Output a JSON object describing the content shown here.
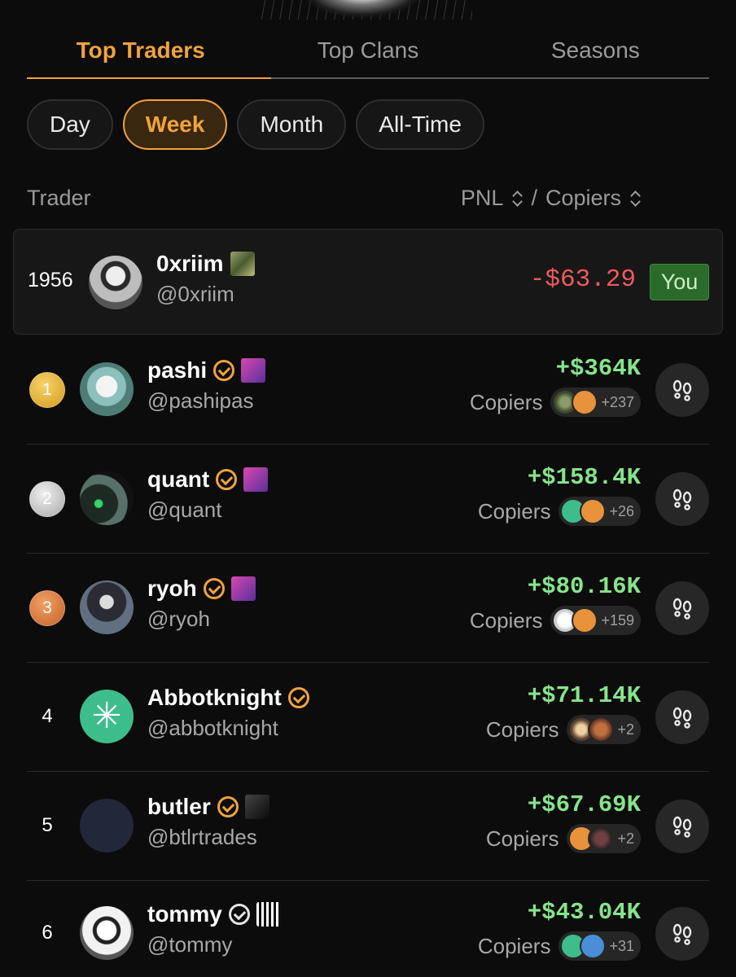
{
  "tabs": [
    {
      "label": "Top Traders",
      "active": true
    },
    {
      "label": "Top Clans",
      "active": false
    },
    {
      "label": "Seasons",
      "active": false
    }
  ],
  "periods": [
    {
      "label": "Day",
      "active": false
    },
    {
      "label": "Week",
      "active": true
    },
    {
      "label": "Month",
      "active": false
    },
    {
      "label": "All-Time",
      "active": false
    }
  ],
  "columns": {
    "trader": "Trader",
    "pnl": "PNL",
    "separator": "/",
    "copiers": "Copiers"
  },
  "current_user": {
    "rank": "1956",
    "name": "0xriim",
    "handle": "@0xriim",
    "pnl": "-$63.29",
    "you_badge": "You"
  },
  "traders": [
    {
      "rank": "1",
      "medal": "gold",
      "name": "pashi",
      "handle": "@pashipas",
      "pnl": "+$364K",
      "copiers_label": "Copiers",
      "copiers_extra": "+237"
    },
    {
      "rank": "2",
      "medal": "silver",
      "name": "quant",
      "handle": "@quant",
      "pnl": "+$158.4K",
      "copiers_label": "Copiers",
      "copiers_extra": "+26"
    },
    {
      "rank": "3",
      "medal": "bronze",
      "name": "ryoh",
      "handle": "@ryoh",
      "pnl": "+$80.16K",
      "copiers_label": "Copiers",
      "copiers_extra": "+159"
    },
    {
      "rank": "4",
      "name": "Abbotknight",
      "handle": "@abbotknight",
      "pnl": "+$71.14K",
      "copiers_label": "Copiers",
      "copiers_extra": "+2"
    },
    {
      "rank": "5",
      "name": "butler",
      "handle": "@btlrtrades",
      "pnl": "+$67.69K",
      "copiers_label": "Copiers",
      "copiers_extra": "+2"
    },
    {
      "rank": "6",
      "name": "tommy",
      "handle": "@tommy",
      "pnl": "+$43.04K",
      "copiers_label": "Copiers",
      "copiers_extra": "+31"
    }
  ],
  "colors": {
    "accent": "#f2a23c",
    "positive": "#86e48b",
    "negative": "#ef5a5a",
    "background": "#0c0c0c"
  },
  "icons": {
    "sort": "sort-updown-icon",
    "copy": "footprints-icon",
    "verified": "verified-check-icon"
  }
}
